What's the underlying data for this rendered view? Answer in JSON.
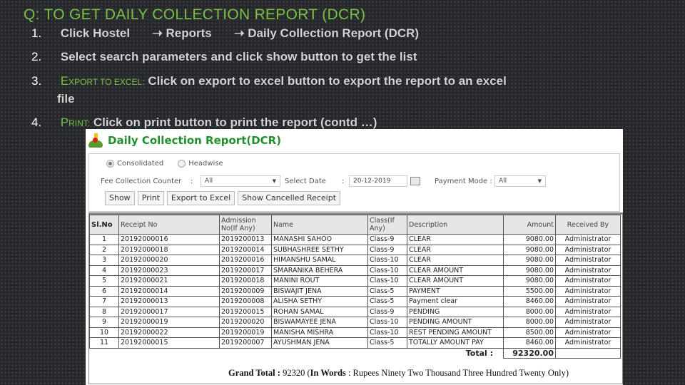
{
  "slide": {
    "title": "Q: TO GET DAILY COLLECTION REPORT (DCR)",
    "steps": [
      {
        "num": "1.",
        "parts": [
          "Click Hostel",
          "Reports",
          "Daily Collection  Report (DCR)"
        ],
        "arrow": "➝"
      },
      {
        "num": "2.",
        "text": "Select search parameters and click show button   to get the list"
      },
      {
        "num": "3.",
        "label_first": "E",
        "label_rest": "XPORT TO EXCEL:",
        "text": "Click on export to excel button to export    the report to an excel",
        "text_cont": "file"
      },
      {
        "num": "4.",
        "label_first": "P",
        "label_rest": "RINT:",
        "text": "Click on print button  to print  the report (contd …)"
      }
    ]
  },
  "report": {
    "title": "Daily Collection Report(DCR)",
    "radio_options": [
      {
        "label": "Consolidated",
        "selected": true
      },
      {
        "label": "Headwise",
        "selected": false
      }
    ],
    "fee_counter_label": "Fee Collection Counter",
    "fee_counter_value": "All",
    "select_date_label": "Select Date",
    "select_date_value": "20-12-2019",
    "payment_mode_label": "Payment Mode :",
    "payment_mode_value": "All",
    "colon": ":",
    "dropdown_arrow": "▼",
    "buttons": {
      "show": "Show",
      "print": "Print",
      "export": "Export to Excel",
      "cancelled": "Show Cancelled Receipt"
    },
    "columns": [
      "Sl.No",
      "Receipt No",
      "Admission No(If Any)",
      "Name",
      "Class(If Any)",
      "Description",
      "Amount",
      "Received By"
    ],
    "rows": [
      {
        "sl": "1",
        "receipt": "20192000016",
        "admission": "2019200013",
        "name": "MANASHI SAHOO",
        "class": "Class-9",
        "desc": "CLEAR",
        "amount": "9080.00",
        "by": "Administrator"
      },
      {
        "sl": "2",
        "receipt": "20192000018",
        "admission": "2019200014",
        "name": "SUBHASHREE SETHY",
        "class": "Class-9",
        "desc": "CLEAR",
        "amount": "9080.00",
        "by": "Administrator"
      },
      {
        "sl": "3",
        "receipt": "20192000020",
        "admission": "2019200016",
        "name": "HIMANSHU SAMAL",
        "class": "Class-10",
        "desc": "CLEAR",
        "amount": "9080.00",
        "by": "Administrator"
      },
      {
        "sl": "4",
        "receipt": "20192000023",
        "admission": "2019200017",
        "name": "SMARANIKA BEHERA",
        "class": "Class-10",
        "desc": "CLEAR AMOUNT",
        "amount": "9080.00",
        "by": "Administrator"
      },
      {
        "sl": "5",
        "receipt": "20192000021",
        "admission": "2019200018",
        "name": "MANINI ROUT",
        "class": "Class-10",
        "desc": "CLEAR AMOUNT",
        "amount": "9080.00",
        "by": "Administrator"
      },
      {
        "sl": "6",
        "receipt": "20192000014",
        "admission": "2019200009",
        "name": "BISWAJIT JENA",
        "class": "Class-5",
        "desc": "PAYMENT",
        "amount": "5500.00",
        "by": "Administrator"
      },
      {
        "sl": "7",
        "receipt": "20192000013",
        "admission": "2019200008",
        "name": "ALISHA SETHY",
        "class": "Class-5",
        "desc": "Payment clear",
        "amount": "8460.00",
        "by": "Administrator"
      },
      {
        "sl": "8",
        "receipt": "20192000017",
        "admission": "2019200015",
        "name": "ROHAN SAMAL",
        "class": "Class-9",
        "desc": "PENDING",
        "amount": "8000.00",
        "by": "Administrator"
      },
      {
        "sl": "9",
        "receipt": "20192000019",
        "admission": "2019200020",
        "name": "BISWAMAYEE JENA",
        "class": "Class-10",
        "desc": "PENDING AMOUNT",
        "amount": "8000.00",
        "by": "Administrator"
      },
      {
        "sl": "10",
        "receipt": "20192000022",
        "admission": "2019200019",
        "name": "MANISHA MISHRA",
        "class": "Class-10",
        "desc": "REST PENDING AMOUNT",
        "amount": "8500.00",
        "by": "Administrator"
      },
      {
        "sl": "11",
        "receipt": "20192000015",
        "admission": "2019200007",
        "name": "AYUSHMAN JENA",
        "class": "Class-5",
        "desc": "TOTALLY AMOUNT PAY",
        "amount": "8460.00",
        "by": "Administrator"
      }
    ],
    "total_label": "Total :",
    "total_value": "92320.00",
    "grand_total_label": "Grand Total",
    "grand_total_value": "92320",
    "in_words_label": "In Words",
    "in_words_value": "Rupees Ninety Two Thousand Three Hundred Twenty Only"
  }
}
